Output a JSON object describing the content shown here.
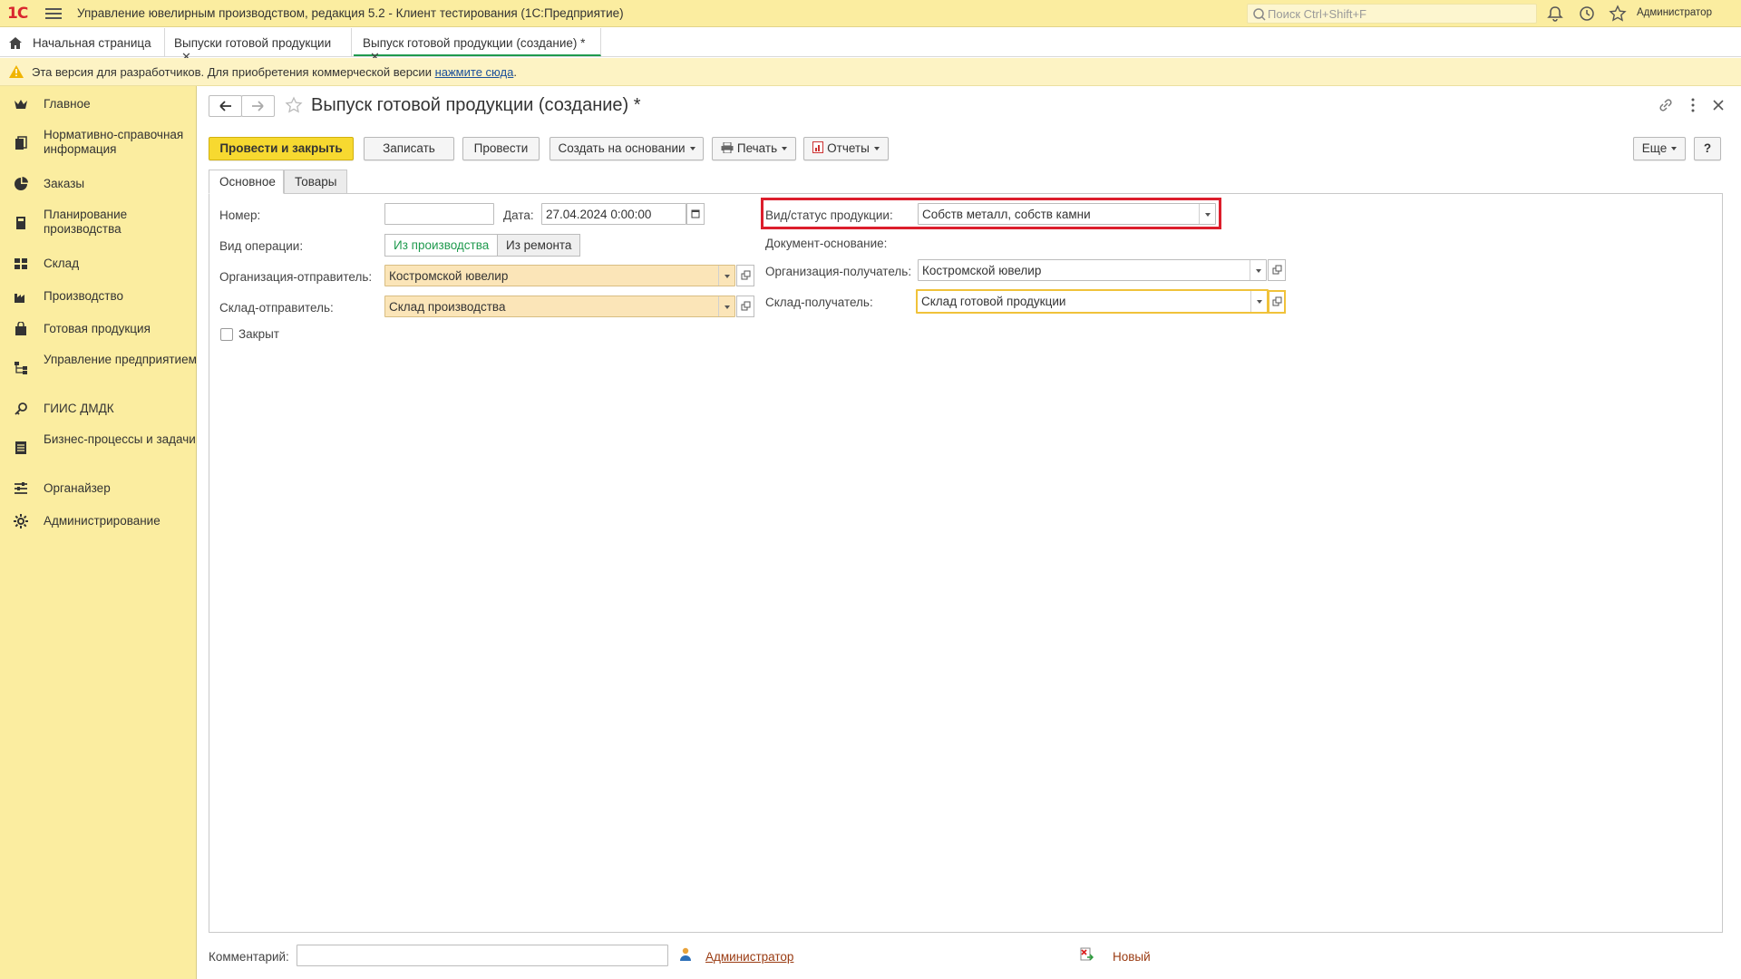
{
  "titlebar": {
    "logo": "1С",
    "title": "Управление ювелирным производством, редакция 5.2  - Клиент тестирования (1С:Предприятие)",
    "search_placeholder": "Поиск Ctrl+Shift+F",
    "user": "Администратор"
  },
  "tabs": [
    {
      "label": "Начальная страница"
    },
    {
      "label": "Выпуски готовой продукции"
    },
    {
      "label": "Выпуск готовой продукции (создание) *"
    }
  ],
  "warning": {
    "text": "Эта версия для разработчиков. Для приобретения коммерческой версии ",
    "link": "нажмите сюда",
    "tail": "."
  },
  "sidebar": {
    "items": [
      {
        "label": "Главное",
        "icon": "crown-icon"
      },
      {
        "label": "Нормативно-справочная информация",
        "icon": "book-icon"
      },
      {
        "label": "Заказы",
        "icon": "pie-icon"
      },
      {
        "label": "Планирование производства",
        "icon": "calculator-icon"
      },
      {
        "label": "Склад",
        "icon": "grid-icon"
      },
      {
        "label": "Производство",
        "icon": "factory-icon"
      },
      {
        "label": "Готовая продукция",
        "icon": "bag-icon"
      },
      {
        "label": "Управление предприятием",
        "icon": "org-icon"
      },
      {
        "label": "ГИИС ДМДК",
        "icon": "key-icon"
      },
      {
        "label": "Бизнес-процессы и задачи",
        "icon": "tasks-icon"
      },
      {
        "label": "Органайзер",
        "icon": "organizer-icon"
      },
      {
        "label": "Администрирование",
        "icon": "gear-icon"
      }
    ]
  },
  "form": {
    "title": "Выпуск готовой продукции (создание) *",
    "buttons": {
      "post_close": "Провести и закрыть",
      "save": "Записать",
      "post": "Провести",
      "create_based": "Создать на основании",
      "print": "Печать",
      "reports": "Отчеты",
      "more": "Еще",
      "help": "?"
    },
    "tabs": {
      "main": "Основное",
      "goods": "Товары"
    },
    "fields": {
      "number_label": "Номер:",
      "number_value": "",
      "date_label": "Дата:",
      "date_value": "27.04.2024  0:00:00",
      "operation_label": "Вид операции:",
      "operation_options": [
        "Из производства",
        "Из ремонта"
      ],
      "sender_org_label": "Организация-отправитель:",
      "sender_org_value": "Костромской ювелир",
      "sender_wh_label": "Склад-отправитель:",
      "sender_wh_value": "Склад производства",
      "closed_label": "Закрыт",
      "product_status_label": "Вид/статус продукции:",
      "product_status_value": "Собств металл, собств камни",
      "base_doc_label": "Документ-основание:",
      "recipient_org_label": "Организация-получатель:",
      "recipient_org_value": "Костромской ювелир",
      "recipient_wh_label": "Склад-получатель:",
      "recipient_wh_value": "Склад готовой продукции"
    },
    "footer": {
      "comment_label": "Комментарий:",
      "comment_value": "",
      "author": "Администратор",
      "state": "Новый"
    }
  },
  "colors": {
    "accent_yellow": "#fbeda0",
    "primary_button": "#f7d930",
    "highlight_red": "#dc1e2c",
    "active_green": "#1f9a4e"
  }
}
